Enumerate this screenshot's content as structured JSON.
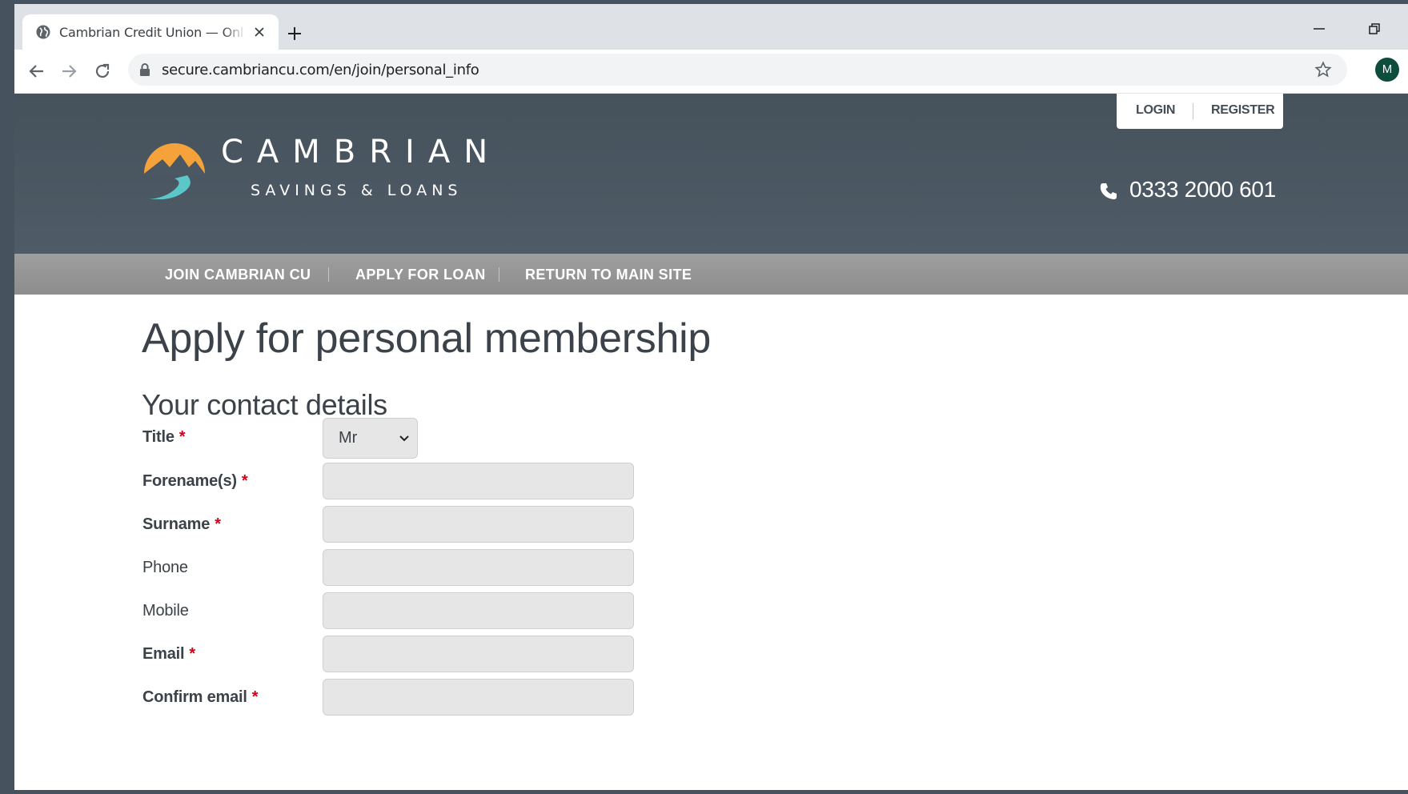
{
  "browser": {
    "tab_title": "Cambrian Credit Union — Online",
    "url": "secure.cambriancu.com/en/join/personal_info",
    "profile_initial": "M"
  },
  "header": {
    "login": "LOGIN",
    "register": "REGISTER",
    "brand_name": "CAMBRIAN",
    "brand_sub": "SAVINGS & LOANS",
    "phone": "0333 2000 601",
    "colors": {
      "header_bg": "#4b5762",
      "logo_orange": "#f5a23a",
      "logo_teal": "#5cc7c9"
    }
  },
  "nav": {
    "items": [
      "JOIN CAMBRIAN CU",
      "APPLY FOR LOAN",
      "RETURN TO MAIN SITE"
    ]
  },
  "main": {
    "title": "Apply for personal membership",
    "section": "Your contact details",
    "required_marker": "*",
    "title_field": {
      "label": "Title",
      "value": "Mr"
    },
    "fields": [
      {
        "label": "Forename(s)",
        "required": true,
        "value": ""
      },
      {
        "label": "Surname",
        "required": true,
        "value": ""
      },
      {
        "label": "Phone",
        "required": false,
        "value": ""
      },
      {
        "label": "Mobile",
        "required": false,
        "value": ""
      },
      {
        "label": "Email",
        "required": true,
        "value": ""
      },
      {
        "label": "Confirm email",
        "required": true,
        "value": ""
      }
    ]
  }
}
